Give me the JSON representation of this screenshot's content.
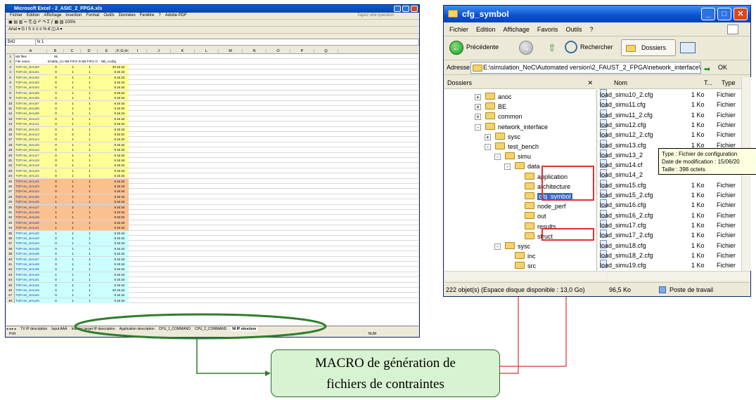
{
  "excel": {
    "title": "Microsoft Excel - 2_ASIC_2_FPGA.xls",
    "menu": [
      "Fichier",
      "Edition",
      "Affichage",
      "Insertion",
      "Format",
      "Outils",
      "Données",
      "Fenêtre",
      "?",
      "Adobe PDF"
    ],
    "help_placeholder": "Tapez une question",
    "font": "Arial",
    "zoom": "100%",
    "namebox": "B42",
    "fx_value": "1",
    "columns": [
      "A",
      "B",
      "C",
      "D",
      "E",
      "F",
      "G",
      "H",
      "I",
      "J",
      "K",
      "L",
      "M",
      "N",
      "O",
      "P",
      "Q"
    ],
    "row1": {
      "label": "NB files",
      "value": "65"
    },
    "headers": [
      "File name",
      "Enable_Conf",
      "NB FIFO IN",
      "NB FIFO OUT",
      "NB_config"
    ],
    "rows": [
      [
        "TOP.res_simu00",
        "0",
        "1",
        "1",
        "33",
        "16",
        "16"
      ],
      [
        "TOP.res_simu01",
        "0",
        "1",
        "1",
        "6",
        "16",
        "16"
      ],
      [
        "TOP.res_simu02",
        "0",
        "1",
        "1",
        "6",
        "16",
        "16"
      ],
      [
        "TOP.res_simu03",
        "0",
        "1",
        "1",
        "6",
        "16",
        "16"
      ],
      [
        "TOP.res_simu04",
        "0",
        "1",
        "1",
        "6",
        "16",
        "16"
      ],
      [
        "TOP.res_simu05",
        "0",
        "1",
        "1",
        "6",
        "16",
        "16"
      ],
      [
        "TOP.res_simu06",
        "0",
        "1",
        "1",
        "6",
        "16",
        "16"
      ],
      [
        "TOP.res_simu07",
        "0",
        "1",
        "1",
        "6",
        "16",
        "16"
      ],
      [
        "TOP.res_simu08",
        "0",
        "1",
        "1",
        "6",
        "16",
        "16"
      ],
      [
        "TOP.res_simu09",
        "0",
        "1",
        "1",
        "6",
        "16",
        "16"
      ],
      [
        "TOP.res_simu10",
        "0",
        "1",
        "1",
        "6",
        "16",
        "16"
      ],
      [
        "TOP.res_simu11",
        "0",
        "1",
        "1",
        "6",
        "16",
        "16"
      ],
      [
        "TOP.res_simu12",
        "0",
        "1",
        "1",
        "6",
        "16",
        "16"
      ],
      [
        "TOP.res_simu13",
        "0",
        "2",
        "1",
        "6",
        "32",
        "32"
      ],
      [
        "TOP.res_simu14",
        "0",
        "1",
        "1",
        "6",
        "16",
        "16"
      ],
      [
        "TOP.res_simu15",
        "0",
        "1",
        "1",
        "6",
        "16",
        "16"
      ],
      [
        "TOP.res_simu16",
        "0",
        "1",
        "1",
        "6",
        "16",
        "16"
      ],
      [
        "TOP.res_simu17",
        "0",
        "1",
        "1",
        "6",
        "16",
        "16"
      ],
      [
        "TOP.res_simu18",
        "0",
        "1",
        "1",
        "6",
        "16",
        "16"
      ],
      [
        "TOP.res_simu19",
        "0",
        "1",
        "1",
        "6",
        "16",
        "16"
      ],
      [
        "TOP.res_simu20",
        "1",
        "1",
        "1",
        "6",
        "16",
        "16"
      ],
      [
        "TOP.res_simu21",
        "0",
        "1",
        "1",
        "6",
        "16",
        "16"
      ],
      [
        "TOP.res_simu22",
        "0",
        "1",
        "1",
        "6",
        "16",
        "16"
      ],
      [
        "TOP.res_simu23",
        "0",
        "1",
        "1",
        "6",
        "16",
        "16"
      ],
      [
        "TOP.res_simu24",
        "0",
        "1",
        "1",
        "6",
        "16",
        "16"
      ],
      [
        "TOP.res_simu25",
        "1",
        "1",
        "1",
        "6",
        "16",
        "16"
      ],
      [
        "TOP.res_simu26",
        "1",
        "1",
        "1",
        "6",
        "16",
        "16"
      ],
      [
        "TOP.res_simu27",
        "1",
        "2",
        "1",
        "6",
        "16",
        "16"
      ],
      [
        "TOP.res_simu28",
        "1",
        "1",
        "1",
        "6",
        "16",
        "16"
      ],
      [
        "TOP.res_simu29",
        "1",
        "1",
        "1",
        "6",
        "16",
        "32"
      ],
      [
        "TOP.res_simu30",
        "1",
        "1",
        "1",
        "6",
        "16",
        "16"
      ],
      [
        "TOP.res_simu31",
        "1",
        "1",
        "1",
        "6",
        "16",
        "16"
      ],
      [
        "TOP.res_simu32",
        "1",
        "1",
        "1",
        "6",
        "16",
        "16"
      ],
      [
        "TOP.res_simu33",
        "0",
        "1",
        "1",
        "6",
        "16",
        "16"
      ],
      [
        "TOP.res_simu34",
        "0",
        "1",
        "1",
        "6",
        "16",
        "16"
      ],
      [
        "TOP.res_simu35",
        "0",
        "1",
        "1",
        "6",
        "16",
        "16"
      ],
      [
        "TOP.res_simu36",
        "0",
        "1",
        "1",
        "6",
        "16",
        "16"
      ],
      [
        "TOP.res_simu37",
        "0",
        "1",
        "1",
        "6",
        "16",
        "16"
      ],
      [
        "TOP.res_simu38",
        "0",
        "1",
        "1",
        "6",
        "16",
        "16"
      ],
      [
        "TOP.res_simu39",
        "0",
        "1",
        "1",
        "6",
        "16",
        "16"
      ],
      [
        "TOP.res_simu40",
        "1",
        "1",
        "1",
        "6",
        "16",
        "16"
      ],
      [
        "TOP.res_simu41",
        "0",
        "1",
        "1",
        "6",
        "16",
        "16"
      ],
      [
        "TOP.res_simu42",
        "0",
        "1",
        "1",
        "6",
        "16",
        "16"
      ],
      [
        "TOP.res_simu43",
        "0",
        "1",
        "1",
        "33",
        "16",
        "16"
      ],
      [
        "TOP.res_simu44",
        "0",
        "1",
        "1",
        "6",
        "16",
        "16"
      ],
      [
        "TOP.res_simu45",
        "0",
        "1",
        "1",
        "6",
        "16",
        "16"
      ]
    ],
    "row_bands": [
      {
        "from": 3,
        "to": 24,
        "color": "#ffff99"
      },
      {
        "from": 25,
        "to": 34,
        "color": "#fbc08f"
      },
      {
        "from": 35,
        "to": 48,
        "color": "#ccffff"
      }
    ],
    "sheet_tabs": [
      "TX IP description",
      "Input AAA",
      "Initiator target IP description",
      "Application description",
      "CPU_1_COMMAND",
      "CPU_2_COMMAND",
      "NI IP structure"
    ],
    "active_tab": "NI IP structure",
    "status_left": "Prêt",
    "status_right": "NUM"
  },
  "explorer": {
    "title": "cfg_symbol",
    "menu": [
      "Fichier",
      "Edition",
      "Affichage",
      "Favoris",
      "Outils",
      "?"
    ],
    "back_label": "Précédente",
    "search_label": "Rechercher",
    "folders_label": "Dossiers",
    "address_label": "Adresse",
    "address_value": "E:\\simulation_NoC\\Automated version\\2_FAUST_2_FPGA\\network_interface\\",
    "go_label": "OK",
    "tree_header": "Dossiers",
    "col_name": "Nom",
    "col_size": "T...",
    "col_type": "Type",
    "tree": [
      {
        "label": "anoc",
        "expander": "+"
      },
      {
        "label": "BE",
        "expander": "+"
      },
      {
        "label": "common",
        "expander": "+"
      },
      {
        "label": "network_interface",
        "expander": "-"
      },
      {
        "label": "sysc",
        "expander": "+"
      },
      {
        "label": "test_bench",
        "expander": "-"
      },
      {
        "label": "simu",
        "expander": "-"
      },
      {
        "label": "data",
        "expander": "-"
      },
      {
        "label": "application",
        "expander": ""
      },
      {
        "label": "architecture",
        "expander": ""
      },
      {
        "label": "cfg_symbol",
        "expander": ""
      },
      {
        "label": "node_perf",
        "expander": ""
      },
      {
        "label": "out",
        "expander": ""
      },
      {
        "label": "results",
        "expander": ""
      },
      {
        "label": "struct",
        "expander": ""
      },
      {
        "label": "sysc",
        "expander": "-"
      },
      {
        "label": "inc",
        "expander": ""
      },
      {
        "label": "src",
        "expander": ""
      }
    ],
    "files": [
      {
        "name": "load_simu10_2.cfg",
        "size": "1 Ko",
        "type": "Fichier"
      },
      {
        "name": "load_simu11.cfg",
        "size": "1 Ko",
        "type": "Fichier"
      },
      {
        "name": "load_simu11_2.cfg",
        "size": "1 Ko",
        "type": "Fichier"
      },
      {
        "name": "load_simu12.cfg",
        "size": "1 Ko",
        "type": "Fichier"
      },
      {
        "name": "load_simu12_2.cfg",
        "size": "1 Ko",
        "type": "Fichier"
      },
      {
        "name": "load_simu13.cfg",
        "size": "1 Ko",
        "type": "Fichier"
      },
      {
        "name": "load_simu13_2",
        "size": "",
        "type": ""
      },
      {
        "name": "load_simu14.cf",
        "size": "",
        "type": ""
      },
      {
        "name": "load_simu14_2",
        "size": "",
        "type": ""
      },
      {
        "name": "load_simu15.cfg",
        "size": "1 Ko",
        "type": "Fichier"
      },
      {
        "name": "load_simu15_2.cfg",
        "size": "1 Ko",
        "type": "Fichier"
      },
      {
        "name": "load_simu16.cfg",
        "size": "1 Ko",
        "type": "Fichier"
      },
      {
        "name": "load_simu16_2.cfg",
        "size": "1 Ko",
        "type": "Fichier"
      },
      {
        "name": "load_simu17.cfg",
        "size": "1 Ko",
        "type": "Fichier"
      },
      {
        "name": "load_simu17_2.cfg",
        "size": "1 Ko",
        "type": "Fichier"
      },
      {
        "name": "load_simu18.cfg",
        "size": "1 Ko",
        "type": "Fichier"
      },
      {
        "name": "load_simu18_2.cfg",
        "size": "1 Ko",
        "type": "Fichier"
      },
      {
        "name": "load_simu19.cfg",
        "size": "1 Ko",
        "type": "Fichier"
      }
    ],
    "tooltip": {
      "type": "Type : Fichier de configuration",
      "date": "Date de modification : 15/06/20",
      "size": "Taille : 398 octets"
    },
    "status_objects": "222 objet(s) (Espace disque disponible : 13,0 Go)",
    "status_size": "96,5 Ko",
    "status_location": "Poste de travail"
  },
  "callout": {
    "line1": "MACRO de génération de",
    "line2": "fichiers de contraintes"
  },
  "colors": {
    "arrow_green": "#2e7d2e",
    "arrow_red": "#e03030",
    "callout_bg": "#d8f3d2",
    "title_blue": "#0a4fd0"
  }
}
